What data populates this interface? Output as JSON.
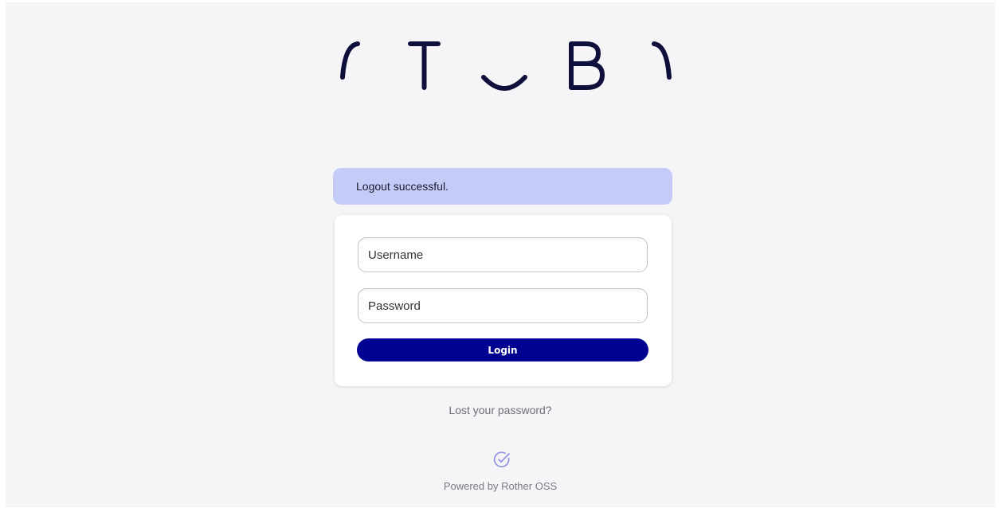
{
  "logo": {
    "alt": "OTOBO",
    "icon": "otobo-logo",
    "color": "#0f0f3c"
  },
  "notification": {
    "text": "Logout successful.",
    "color": "#c5cbf7"
  },
  "login_form": {
    "username": {
      "value": "",
      "placeholder": "Username"
    },
    "password": {
      "value": "",
      "placeholder": "Password"
    },
    "login_label": "Login",
    "button_color": "#000091"
  },
  "lost_password": {
    "label": "Lost your password?"
  },
  "footer": {
    "powered_by": "Powered by Rother OSS",
    "icon": "check-circle-icon"
  }
}
